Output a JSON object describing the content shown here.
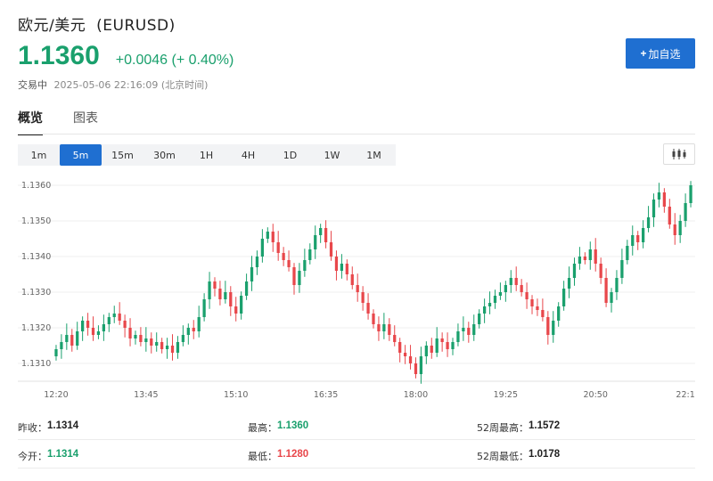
{
  "header": {
    "title": "欧元/美元",
    "symbol": "(EURUSD)",
    "price": "1.1360",
    "change": "+0.0046",
    "change_pct": "(+ 0.40%)",
    "status": "交易中",
    "datetime": "2025-05-06 22:16:09",
    "timezone": "(北京时间)"
  },
  "add_button": {
    "plus": "+",
    "label": "加自选"
  },
  "tabs": [
    {
      "label": "概览",
      "active": true
    },
    {
      "label": "图表",
      "active": false
    }
  ],
  "timeframes": [
    {
      "label": "1m",
      "active": false
    },
    {
      "label": "5m",
      "active": true
    },
    {
      "label": "15m",
      "active": false
    },
    {
      "label": "30m",
      "active": false
    },
    {
      "label": "1H",
      "active": false
    },
    {
      "label": "4H",
      "active": false
    },
    {
      "label": "1D",
      "active": false
    },
    {
      "label": "1W",
      "active": false
    },
    {
      "label": "1M",
      "active": false
    }
  ],
  "chart_type_icon": "candlestick-chart-icon",
  "colors": {
    "up": "#1aa06d",
    "down": "#e8474b",
    "accent": "#1f6fd1"
  },
  "chart_data": {
    "type": "candlestick",
    "y_ticks": [
      "1.1360",
      "1.1350",
      "1.1340",
      "1.1330",
      "1.1320",
      "1.1310"
    ],
    "x_ticks": [
      "12:20",
      "13:45",
      "15:10",
      "16:35",
      "18:00",
      "19:25",
      "20:50",
      "22:1"
    ],
    "ylim": [
      1.1305,
      1.1362
    ],
    "x_tick_index": [
      0,
      17,
      34,
      51,
      68,
      85,
      102,
      119
    ],
    "closes": [
      1.1314,
      1.1316,
      1.1318,
      1.1315,
      1.1319,
      1.1322,
      1.132,
      1.1318,
      1.1319,
      1.1321,
      1.1323,
      1.1324,
      1.1322,
      1.132,
      1.1317,
      1.1318,
      1.1316,
      1.1317,
      1.1315,
      1.1316,
      1.1314,
      1.1315,
      1.1313,
      1.1316,
      1.1318,
      1.132,
      1.1319,
      1.1323,
      1.1328,
      1.1333,
      1.1331,
      1.1328,
      1.133,
      1.1326,
      1.1324,
      1.1329,
      1.1333,
      1.1337,
      1.134,
      1.1345,
      1.1347,
      1.1344,
      1.1341,
      1.1339,
      1.1337,
      1.1332,
      1.1336,
      1.1339,
      1.1342,
      1.1346,
      1.1348,
      1.1344,
      1.134,
      1.1336,
      1.1338,
      1.1335,
      1.1332,
      1.133,
      1.1327,
      1.1324,
      1.1321,
      1.1319,
      1.1321,
      1.1318,
      1.1316,
      1.1313,
      1.1312,
      1.131,
      1.1307,
      1.1312,
      1.1315,
      1.1313,
      1.1317,
      1.1316,
      1.1314,
      1.1316,
      1.1319,
      1.132,
      1.1318,
      1.1321,
      1.1324,
      1.1326,
      1.1327,
      1.1329,
      1.133,
      1.1332,
      1.1334,
      1.1332,
      1.133,
      1.1328,
      1.1326,
      1.1325,
      1.1323,
      1.1318,
      1.1322,
      1.1326,
      1.1331,
      1.1334,
      1.1338,
      1.134,
      1.1339,
      1.1342,
      1.1338,
      1.1334,
      1.1327,
      1.133,
      1.1334,
      1.1339,
      1.1343,
      1.1346,
      1.1344,
      1.1348,
      1.1351,
      1.1356,
      1.1358,
      1.1354,
      1.1349,
      1.1346,
      1.135,
      1.1355,
      1.136
    ]
  },
  "stats": {
    "row1": [
      {
        "key": "昨收：",
        "value": "1.1314",
        "color": "black"
      },
      {
        "key": "最高：",
        "value": "1.1360",
        "color": "green"
      },
      {
        "key": "52周最高：",
        "value": "1.1572",
        "color": "black"
      }
    ],
    "row2": [
      {
        "key": "今开：",
        "value": "1.1314",
        "color": "green"
      },
      {
        "key": "最低：",
        "value": "1.1280",
        "color": "red"
      },
      {
        "key": "52周最低：",
        "value": "1.0178",
        "color": "black"
      }
    ]
  }
}
